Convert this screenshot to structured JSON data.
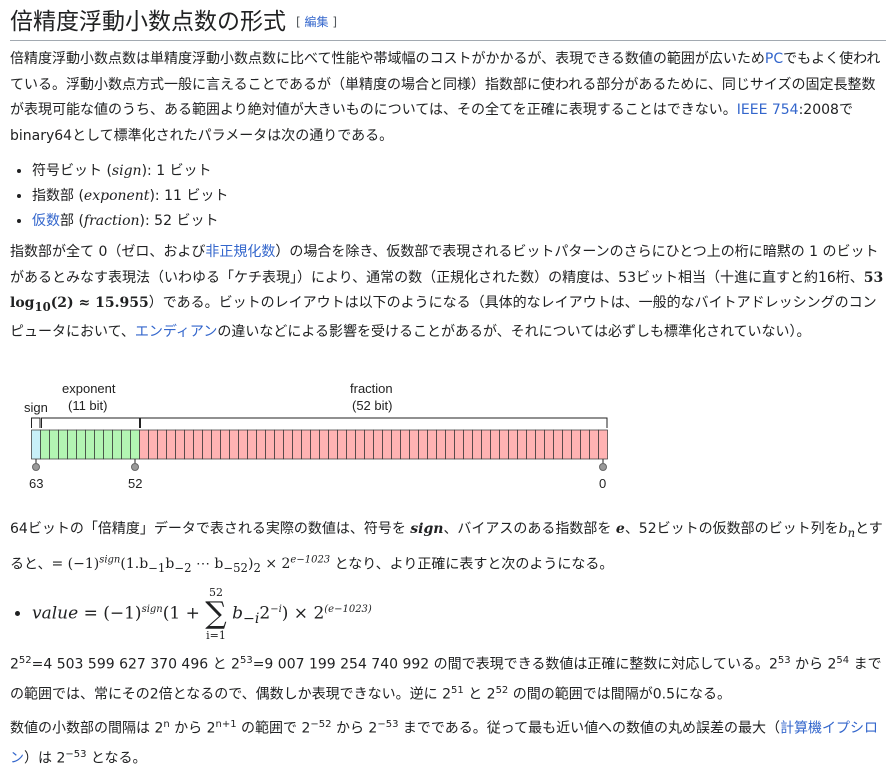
{
  "heading": {
    "title": "倍精度浮動小数点数の形式",
    "edit_open": "[",
    "edit_label": "編集",
    "edit_close": "]"
  },
  "intro": {
    "text1": "倍精度浮動小数点数は単精度浮動小数点数に比べて性能や帯域幅のコストがかかるが、表現できる数値の範囲が広いため",
    "link_pc": "PC",
    "text2": "でもよく使われている。浮動小数点方式一般に言えることであるが（単精度の場合と同様）指数部に使われる部分があるために、同じサイズの固定長整数が表現可能な値のうち、ある範囲より絶対値が大きいものについては、その全てを正確に表現することはできない。",
    "link_ieee": "IEEE 754",
    "text3": ":2008でbinary64として標準化されたパラメータは次の通りである。"
  },
  "fields": [
    {
      "pre": "符号ビット (",
      "link": "",
      "post": "",
      "var": "sign",
      "bits": "): 1 ビット"
    },
    {
      "pre": "指数部 (",
      "link": "",
      "post": "",
      "var": "exponent",
      "bits": "): 11 ビット"
    },
    {
      "pre": "",
      "link": "仮数",
      "post": "部 (",
      "var": "fraction",
      "bits": "): 52 ビット"
    }
  ],
  "precision": {
    "t1": "指数部が全て 0（ゼロ、および",
    "link_subnormal": "非正規化数",
    "t2": "）の場合を除き、仮数部で表現されるビットパターンのさらにひとつ上の桁に暗黙の 1 のビットがあるとみなす表現法（いわゆる「ケチ表現」）により、通常の数（正規化された数）の精度は、53ビット相当（十進に直すと約16桁、",
    "m1": "53 log",
    "m1sub": "10",
    "m2": "(2) ≈ 15.955",
    "t3": "）である。ビットのレイアウトは以下のようになる（具体的なレイアウトは、一般的なバイトアドレッシングのコンピュータにおいて、",
    "link_endian": "エンディアン",
    "t4": "の違いなどによる影響を受けることがあるが、それについては必ずしも標準化されていない）。"
  },
  "diagram": {
    "sign_label": "sign",
    "exp_label": "exponent",
    "exp_bits": "(11 bit)",
    "frac_label": "fraction",
    "frac_bits": "(52 bit)",
    "bit_63": "63",
    "bit_52": "52",
    "bit_0": "0",
    "sign_color": "#c8f0f8",
    "exp_color": "#b3f5b3",
    "frac_color": "#ffb3b3"
  },
  "value_intro": {
    "t1": "64ビットの「倍精度」データで表される実際の数値は、符号を ",
    "v_sign": "sign",
    "t2": "、バイアスのある指数部を ",
    "v_e": "e",
    "t3": "、52ビットの仮数部のビット列を",
    "v_b": "b",
    "v_bsub": "n",
    "t4": "とすると、",
    "f1": "= (−1)",
    "f1sup": "sign",
    "f2": "(1.b",
    "f2s1": "−1",
    "f3": "b",
    "f3s": "−2",
    "f4": " ⋯ b",
    "f4s": "−52",
    "f5": ")",
    "f5s": "2",
    "f6": " × 2",
    "f6sup": "e−1023",
    "t5": " となり、より正確に表すと次のようになる。"
  },
  "formula": {
    "lhs": "value",
    "eq": " = (−1)",
    "sup_sign": "sign",
    "mid": "(1 + ",
    "sum_top": "52",
    "sum_sym": "∑",
    "sum_bot": "i=1",
    "term_b": " b",
    "term_bsub": "−i",
    "term_2": "2",
    "term_2sup": "−i",
    "tail": ") × 2",
    "tail_sup": "(e−1023)"
  },
  "ints": {
    "a1": "2",
    "a1sup": "52",
    "a2": "=4 503 599 627 370 496 と 2",
    "a2sup": "53",
    "a3": "=9 007 199 254 740 992 の間で表現できる数値は正確に整数に対応している。2",
    "a3sup": "53",
    "a4": " から 2",
    "a4sup": "54",
    "a5": " までの範囲では、常にその2倍となるので、偶数しか表現できない。逆に 2",
    "a5sup": "51",
    "a6": " と 2",
    "a6sup": "52",
    "a7": " の間の範囲では間隔が0.5になる。"
  },
  "spacing": {
    "b1": "数値の小数部の間隔は 2",
    "b1sup": "n",
    "b2": " から 2",
    "b2sup": "n+1",
    "b3": " の範囲で 2",
    "b3sup": "−52",
    "b4": " から 2",
    "b4sup": "−53",
    "b5": " までである。従って最も近い値への数値の丸め誤差の最大（",
    "link_eps": "計算機イプシロン",
    "b6": "）は 2",
    "b6sup": "−53",
    "b7": " となる。"
  }
}
